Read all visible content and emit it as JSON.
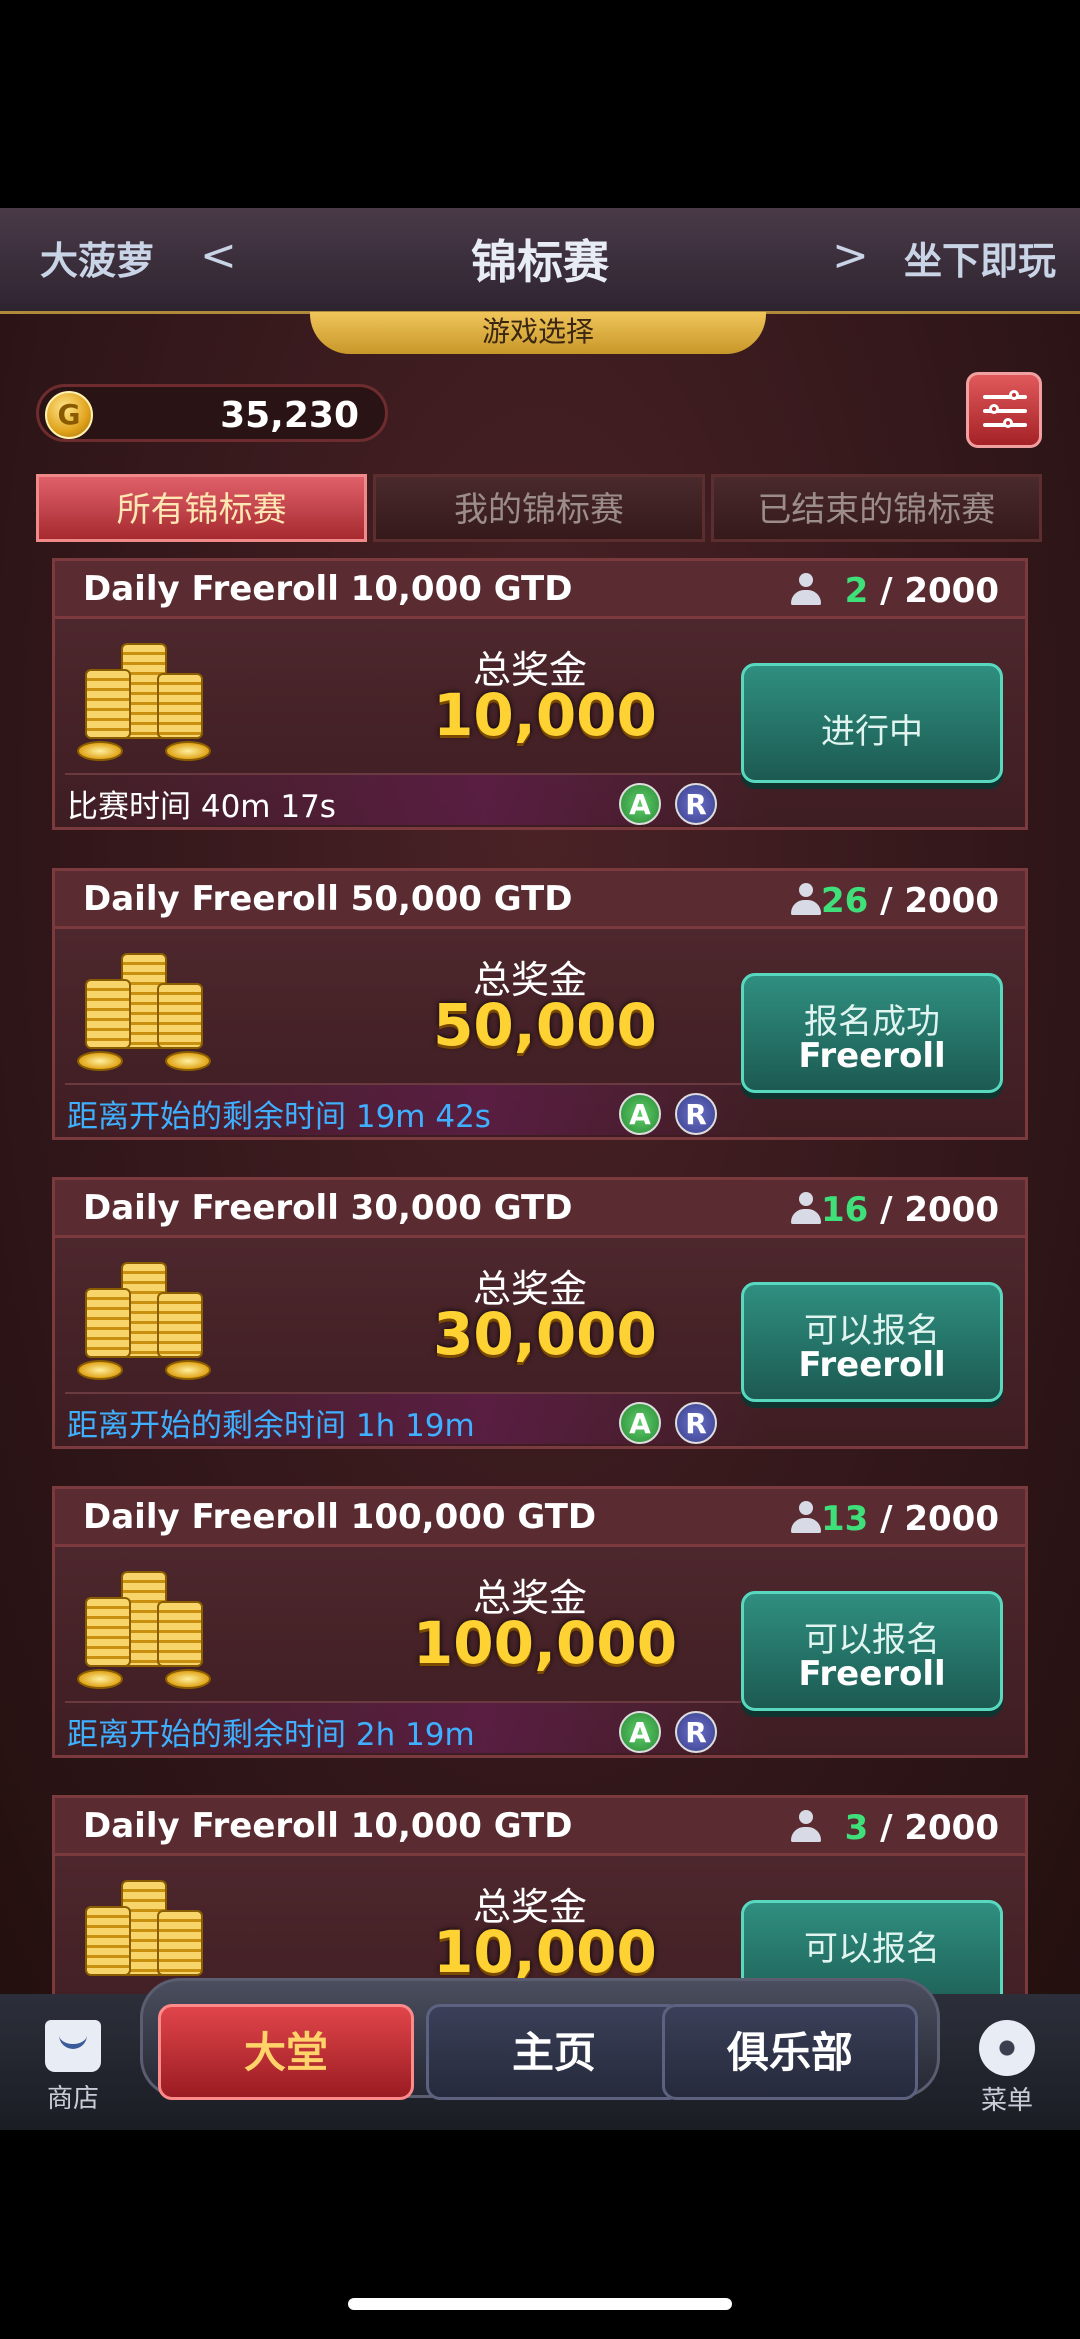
{
  "header": {
    "left_label": "大菠萝",
    "left_arrow": "<",
    "title": "锦标赛",
    "right_arrow": ">",
    "right_label": "坐下即玩",
    "subtitle": "游戏选择"
  },
  "balance": {
    "coin_symbol": "G",
    "amount": "35,230"
  },
  "tabs": [
    {
      "label": "所有锦标赛"
    },
    {
      "label": "我的锦标赛"
    },
    {
      "label": "已结束的锦标赛"
    }
  ],
  "tournaments": [
    {
      "title": "Daily Freeroll 10,000 GTD",
      "players_current": "2",
      "players_max": " / 2000",
      "prize_label": "总奖金",
      "prize": "10,000",
      "time_text": "比赛时间 40m 17s",
      "badge_a": "A",
      "badge_r": "R",
      "button_line1": "进行中",
      "button_line2": ""
    },
    {
      "title": "Daily Freeroll 50,000 GTD",
      "players_current": "26",
      "players_max": " / 2000",
      "prize_label": "总奖金",
      "prize": "50,000",
      "time_text": "距离开始的剩余时间 19m 42s",
      "badge_a": "A",
      "badge_r": "R",
      "button_line1": "报名成功",
      "button_line2": "Freeroll"
    },
    {
      "title": "Daily Freeroll 30,000 GTD",
      "players_current": "16",
      "players_max": " / 2000",
      "prize_label": "总奖金",
      "prize": "30,000",
      "time_text": "距离开始的剩余时间 1h 19m",
      "badge_a": "A",
      "badge_r": "R",
      "button_line1": "可以报名",
      "button_line2": "Freeroll"
    },
    {
      "title": "Daily Freeroll 100,000 GTD",
      "players_current": "13",
      "players_max": " / 2000",
      "prize_label": "总奖金",
      "prize": "100,000",
      "time_text": "距离开始的剩余时间 2h 19m",
      "badge_a": "A",
      "badge_r": "R",
      "button_line1": "可以报名",
      "button_line2": "Freeroll"
    },
    {
      "title": "Daily Freeroll 10,000 GTD",
      "players_current": "3",
      "players_max": " / 2000",
      "prize_label": "总奖金",
      "prize": "10,000",
      "button_line1": "可以报名"
    }
  ],
  "bottom_nav": {
    "shop_label": "商店",
    "lobby": "大堂",
    "home": "主页",
    "club": "俱乐部",
    "menu_label": "菜单"
  },
  "colors": {
    "accent_red": "#a62a30",
    "players_green": "#3fe07a",
    "prize_gold": "#ffd233",
    "countdown_blue": "#3fb0ff",
    "button_teal": "#2f8f80"
  }
}
